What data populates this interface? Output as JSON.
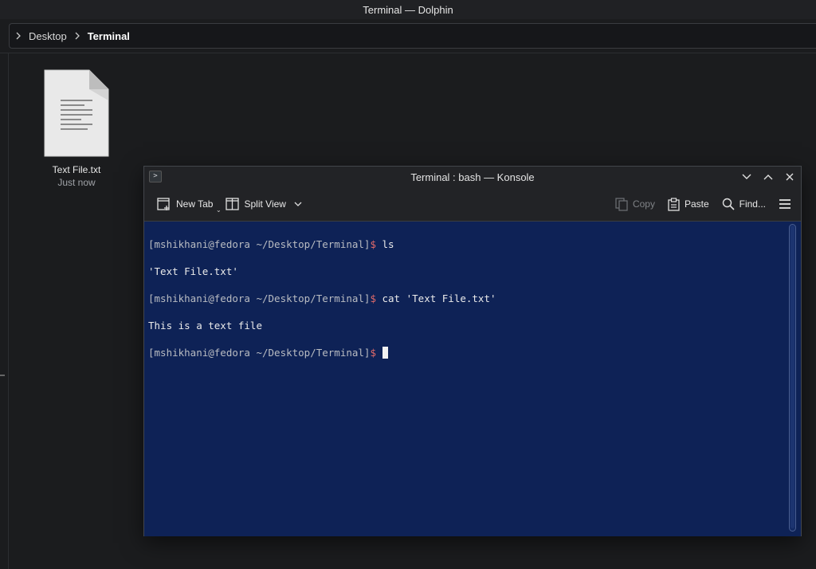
{
  "dolphin": {
    "window_title": "Terminal — Dolphin",
    "breadcrumb": {
      "parent": "Desktop",
      "current": "Terminal"
    },
    "file": {
      "name": "Text File.txt",
      "time": "Just now",
      "icon": "text-file-icon"
    }
  },
  "konsole": {
    "title": "Terminal : bash — Konsole",
    "toolbar": {
      "new_tab": "New Tab",
      "split_view": "Split View",
      "copy": "Copy",
      "paste": "Paste",
      "find": "Find..."
    },
    "terminal": {
      "line1_prompt": "[mshikhani@fedora ~/Desktop/Terminal]",
      "line1_dollar": "$",
      "line1_cmd": " ls",
      "line2": "'Text File.txt'",
      "line3_prompt": "[mshikhani@fedora ~/Desktop/Terminal]",
      "line3_dollar": "$",
      "line3_cmd": " cat 'Text File.txt'",
      "line4": "This is a text file",
      "line5_prompt": "[mshikhani@fedora ~/Desktop/Terminal]",
      "line5_dollar": "$"
    }
  },
  "colors": {
    "terminal_background": "#0e2256",
    "prompt_dollar": "#e06a6a",
    "desktop_background": "#1b1c1e"
  }
}
